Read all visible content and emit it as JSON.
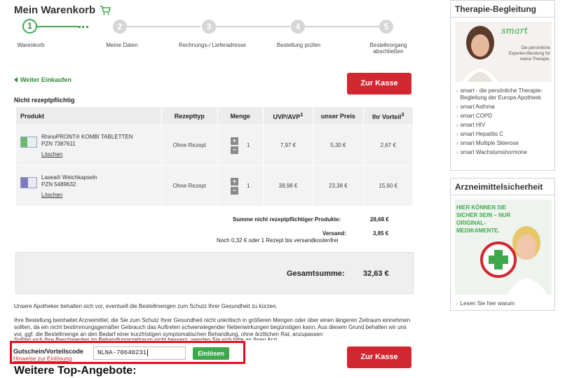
{
  "cart": {
    "title": "Mein Warenkorb",
    "steps": [
      {
        "num": "1",
        "label": "Warenkorb"
      },
      {
        "num": "2",
        "label": "Meine Daten"
      },
      {
        "num": "3",
        "label": "Rechnungs-/ Lieferadresse"
      },
      {
        "num": "4",
        "label": "Bestellung prüfen"
      },
      {
        "num": "5",
        "label": "Bestellvorgang abschließen"
      }
    ],
    "active_step": 1,
    "back_link": "Weiter Einkaufen",
    "checkout_label": "Zur Kasse",
    "section_label": "Nicht rezeptpflichtig",
    "columns": [
      "Produkt",
      "Rezepttyp",
      "Menge",
      "UVP/AVP",
      "unser Preis",
      "Ihr Vorteil"
    ],
    "uvp_sup": "1",
    "vorteil_sup": "3",
    "items": [
      {
        "name": "RhinoPRONT® KOMBI TABLETTEN",
        "pzn": "PZN 7387611",
        "delete": "Löschen",
        "rezepttyp": "Ohne Rezept",
        "plus": "+",
        "minus": "−",
        "qty": "1",
        "uvp": "7,97 €",
        "price": "5,30 €",
        "vorteil": "2,67 €"
      },
      {
        "name": "Lasea® Weichkapseln",
        "pzn": "PZN 5489632",
        "delete": "Löschen",
        "rezepttyp": "Ohne Rezept",
        "plus": "+",
        "minus": "−",
        "qty": "1",
        "uvp": "38,98 €",
        "price": "23,38 €",
        "vorteil": "15,60 €"
      }
    ],
    "summary": {
      "subtotal_label": "Summe nicht rezeptpflichtiger Produkte:",
      "subtotal_value": "28,68 €",
      "shipping_label": "Versand:",
      "shipping_value": "3,95 €",
      "shipping_note": "Noch 0,32 € oder 1 Rezept bis versandkostenfrei",
      "total_label": "Gesamtsumme:",
      "total_value": "32,63 €"
    },
    "notice1": "Unsere Apotheker behalten sich vor, eventuell die Bestellmengen zum Schutz Ihrer Gesundheit zu kürzen.",
    "notice2": "Ihre Bestellung beinhaltet Arzneimittel, die Sie zum Schutz Ihrer Gesundheit nicht unkritisch in größeren Mengen oder über einen längeren Zeitraum einnehmen sollten, da ein nicht bestimmungsgemäßer Gebrauch das Auftreten schwerwiegender Nebenwirkungen begünstigen kann. Aus diesem Grund behalten wir uns vor, ggf. die Bestellmenge an den Bedarf einer kurzfristigen symptomatischen Behandlung, ohne ärztlichen Rat, anzupassen",
    "notice3": "Sollten sich Ihre Beschwerden im Behandlungszeitraum nicht bessern, wenden Sie sich bitte an Ihren Arzt.",
    "coupon": {
      "title": "Gutschein/Vorteilscode",
      "hint": "Hinweise zur Einlösung",
      "value": "NLNA-70640231",
      "button": "Einlösen"
    },
    "more_title": "Weitere Top-Angebote:"
  },
  "sidebar": {
    "box1": {
      "title": "Therapie-Begleitung",
      "img_brand": "smart",
      "img_caption": "Die persönliche Experten-Beratung für meine Therapie.",
      "items": [
        "smart - die persönliche Therapie-Begleitung der Europa Apotheek",
        "smart Asthma",
        "smart COPD",
        "smart HIV",
        "smart Hepatitis C",
        "smart Multiple Sklerose",
        "smart Wachstumshormone"
      ]
    },
    "box2": {
      "title": "Arzneimittelsicherheit",
      "img_text": "HIER KÖNNEN SIE SICHER SEIN – NUR ORIGINAL-MEDIKAMENTE.",
      "link": "Lesen Sie hier warum"
    }
  },
  "colors": {
    "accent_green": "#3ea84d",
    "accent_red": "#d22630",
    "highlight_border": "#e0101c"
  }
}
